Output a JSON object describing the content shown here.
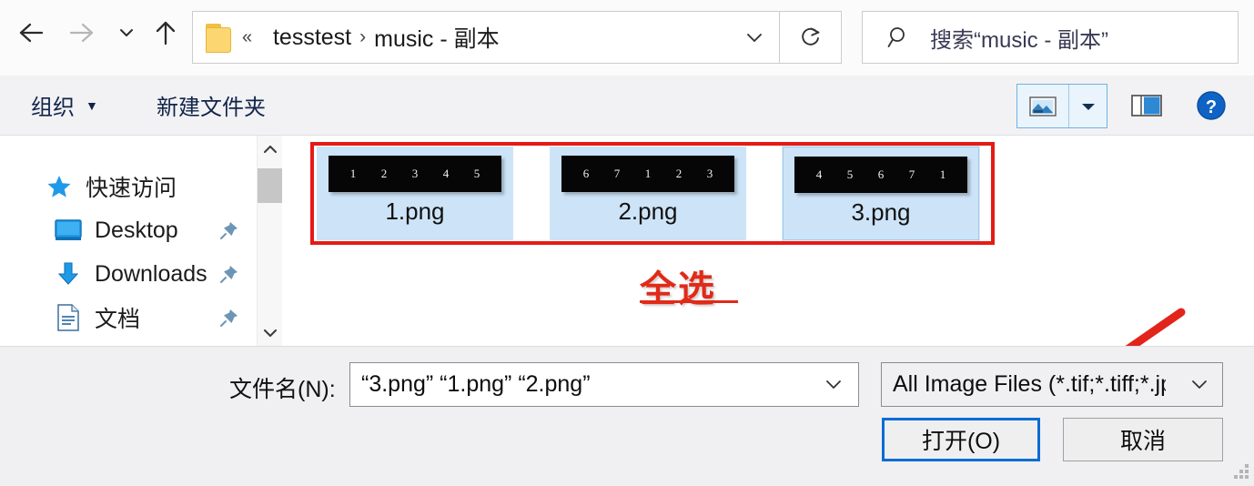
{
  "window": {
    "type": "file-open-dialog",
    "platform": "Windows File Explorer Open Dialog"
  },
  "navbar": {
    "back_icon": "arrow-left-icon",
    "forward_icon": "arrow-right-icon",
    "recent_icon": "chevron-down-icon",
    "up_icon": "arrow-up-icon",
    "folder_icon": "folder-icon",
    "breadcrumb_overflow": "«",
    "breadcrumbs": [
      {
        "label": "tesstest"
      },
      {
        "label": "music - 副本"
      }
    ],
    "separator": "›",
    "address_dropdown_icon": "chevron-down-icon",
    "refresh_icon": "refresh-icon",
    "search": {
      "icon": "search-icon",
      "placeholder": "搜索“music - 副本”"
    }
  },
  "toolbar": {
    "organize_label": "组织",
    "organize_caret": "▼",
    "new_folder_label": "新建文件夹",
    "view_icon": "thumbnail-view-icon",
    "view_dropdown_icon": "chevron-down-icon",
    "preview_pane_icon": "preview-pane-icon",
    "help_icon": "help-question-icon",
    "accent_color": "#6fb3e0"
  },
  "sidebar": {
    "items": [
      {
        "label": "快速访问",
        "icon": "star-icon",
        "pinned": false
      },
      {
        "label": "Desktop",
        "icon": "monitor-icon",
        "pinned": true
      },
      {
        "label": "Downloads",
        "icon": "download-arrow-icon",
        "pinned": true
      },
      {
        "label": "文档",
        "icon": "document-icon",
        "pinned": true
      }
    ],
    "pin_icon": "pin-icon"
  },
  "scrollbar": {
    "up_icon": "chevron-up-icon",
    "down_icon": "chevron-down-icon"
  },
  "files": [
    {
      "name": "1.png",
      "thumbnail_digits": [
        "1",
        "2",
        "3",
        "4",
        "5"
      ],
      "selected": true,
      "focused": false
    },
    {
      "name": "2.png",
      "thumbnail_digits": [
        "6",
        "7",
        "1",
        "2",
        "3"
      ],
      "selected": true,
      "focused": false
    },
    {
      "name": "3.png",
      "thumbnail_digits": [
        "4",
        "5",
        "6",
        "7",
        "1"
      ],
      "selected": true,
      "focused": true
    }
  ],
  "annotations": {
    "select_all_label": "全选",
    "color": "#e12a18",
    "box_color": "#e41b15",
    "arrow": "red-arrow-pointing-to-filetype"
  },
  "footer": {
    "filename_label": "文件名(N):",
    "filename_value": "“3.png” “1.png” “2.png”",
    "filename_dropdown_icon": "chevron-down-icon",
    "filetype_value": "All Image Files (*.tif;*.tiff;*.jpg",
    "filetype_dropdown_icon": "chevron-down-icon",
    "open_label": "打开(O)",
    "cancel_label": "取消",
    "focus_color": "#0a6cd4",
    "resize_grip_icon": "resize-grip-icon"
  }
}
